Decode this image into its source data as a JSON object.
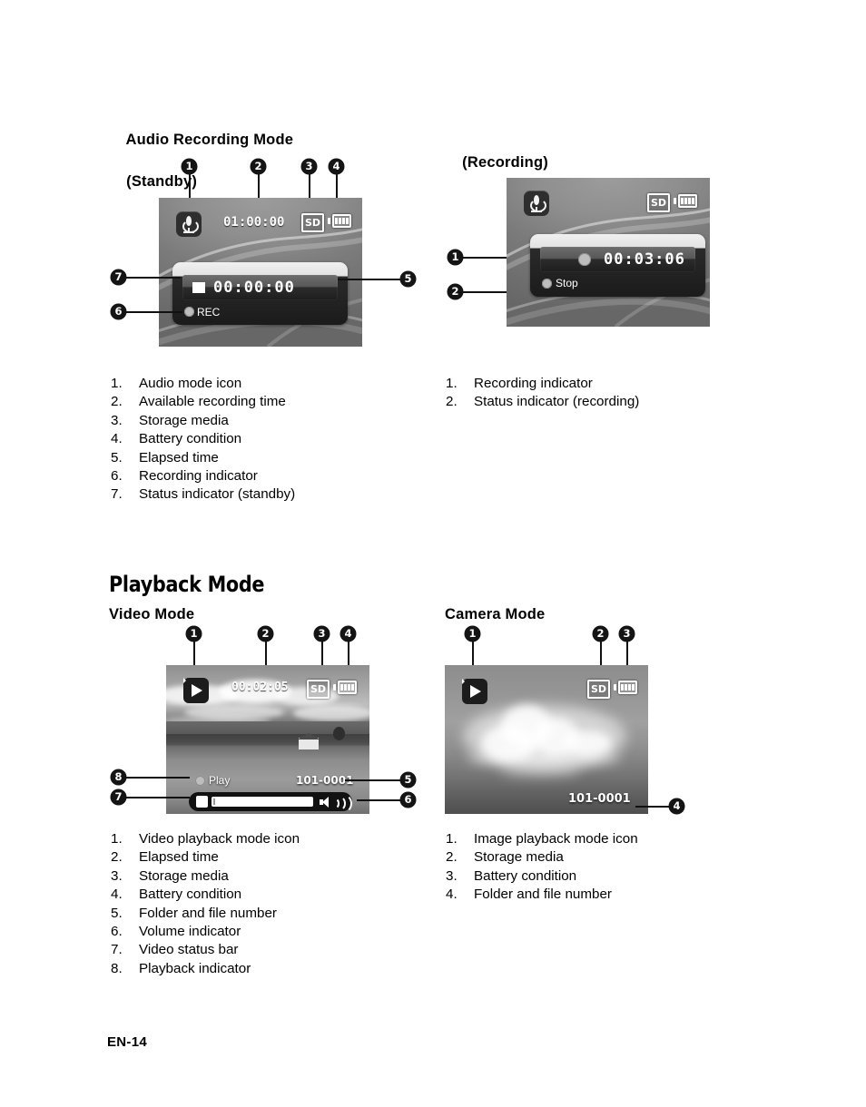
{
  "page": {
    "footer": "EN-14"
  },
  "section_audio": {
    "title_line1": "Audio Recording Mode",
    "title_line2": "(Standby)",
    "title_right": "(Recording)",
    "standby_screen": {
      "mode_icon": "microphone-icon",
      "available_time": "01:00:00",
      "storage_media": "SD",
      "battery_bars": 4,
      "elapsed_time": "00:00:00",
      "status_glyph": "stop-square",
      "recording_label": "REC"
    },
    "recording_screen": {
      "mode_icon": "microphone-icon",
      "storage_media": "SD",
      "battery_bars": 4,
      "elapsed_time": "00:03:06",
      "status_glyph": "record-circle",
      "stop_label": "Stop"
    },
    "callouts_standby": [
      "1",
      "2",
      "3",
      "4",
      "5",
      "6",
      "7"
    ],
    "callouts_recording": [
      "1",
      "2"
    ],
    "list_standby": [
      {
        "n": "1.",
        "t": "Audio mode icon"
      },
      {
        "n": "2.",
        "t": "Available recording time"
      },
      {
        "n": "3.",
        "t": "Storage media"
      },
      {
        "n": "4.",
        "t": "Battery condition"
      },
      {
        "n": "5.",
        "t": "Elapsed time"
      },
      {
        "n": "6.",
        "t": "Recording indicator"
      },
      {
        "n": "7.",
        "t": "Status indicator (standby)"
      }
    ],
    "list_recording": [
      {
        "n": "1.",
        "t": "Recording indicator"
      },
      {
        "n": "2.",
        "t": "Status indicator (recording)"
      }
    ]
  },
  "section_playback": {
    "heading": "Playback Mode",
    "video_title": "Video Mode",
    "camera_title": "Camera Mode",
    "video_screen": {
      "mode_icon": "play-icon",
      "elapsed_time": "00:02:05",
      "storage_media": "SD",
      "battery_bars": 4,
      "playback_label": "Play",
      "file_number": "101-0001",
      "volume_icon": "speaker-waves-icon"
    },
    "camera_screen": {
      "mode_icon": "play-icon",
      "storage_media": "SD",
      "battery_bars": 4,
      "file_number": "101-0001"
    },
    "callouts_video": [
      "1",
      "2",
      "3",
      "4",
      "5",
      "6",
      "7",
      "8"
    ],
    "callouts_camera": [
      "1",
      "2",
      "3",
      "4"
    ],
    "list_video": [
      {
        "n": "1.",
        "t": "Video playback mode icon"
      },
      {
        "n": "2.",
        "t": "Elapsed time"
      },
      {
        "n": "3.",
        "t": "Storage media"
      },
      {
        "n": "4.",
        "t": "Battery condition"
      },
      {
        "n": "5.",
        "t": "Folder and file number"
      },
      {
        "n": "6.",
        "t": "Volume indicator"
      },
      {
        "n": "7.",
        "t": "Video status bar"
      },
      {
        "n": "8.",
        "t": "Playback indicator"
      }
    ],
    "list_camera": [
      {
        "n": "1.",
        "t": "Image playback mode icon"
      },
      {
        "n": "2.",
        "t": "Storage media"
      },
      {
        "n": "3.",
        "t": "Battery condition"
      },
      {
        "n": "4.",
        "t": "Folder and file number"
      }
    ]
  }
}
